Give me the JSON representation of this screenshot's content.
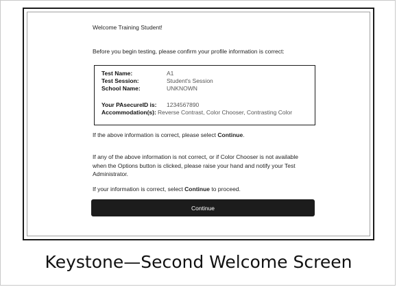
{
  "screen": {
    "welcome": "Welcome Training Student!",
    "intro": "Before you begin testing, please confirm your profile information is correct:",
    "profile": {
      "test_name_label": "Test Name:",
      "test_name_value": "A1",
      "test_session_label": "Test Session:",
      "test_session_value": "Student's Session",
      "school_name_label": "School Name:",
      "school_name_value": "UNKNOWN",
      "pasecure_label": "Your PAsecureID is:",
      "pasecure_value": "1234567890",
      "accommodations_label": "Accommodation(s):",
      "accommodations_value": "Reverse Contrast, Color Chooser, Contrasting Color"
    },
    "confirm": {
      "before": "If the above information is correct, please select ",
      "bold": "Continue",
      "after": "."
    },
    "info_lines": [
      "If any of the above information is not correct, or if Color Chooser is not available",
      "when the Options button is clicked, please raise your hand and notify your Test",
      "Administrator."
    ],
    "proceed": {
      "before": "If your information is correct, select ",
      "bold": "Continue",
      "after": " to proceed."
    },
    "continue_label": "Continue"
  },
  "caption": "Keystone—Second Welcome Screen"
}
